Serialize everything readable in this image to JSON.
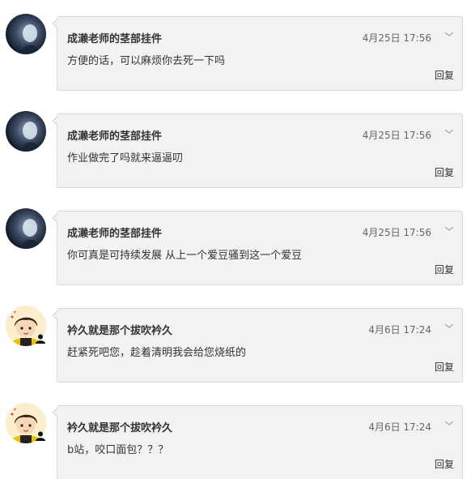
{
  "messages": [
    {
      "sender": "成濑老师的茎部挂件",
      "time": "4月25日 17:56",
      "text": "方便的话，可以麻烦你去死一下吗",
      "reply_label": "回复",
      "avatar_icon": "dark-silhouette-avatar-icon"
    },
    {
      "sender": "成濑老师的茎部挂件",
      "time": "4月25日 17:56",
      "text": "作业做完了吗就来逼逼叨",
      "reply_label": "回复",
      "avatar_icon": "dark-silhouette-avatar-icon"
    },
    {
      "sender": "成濑老师的茎部挂件",
      "time": "4月25日 17:56",
      "text": "你可真是可持续发展 从上一个爱豆骚到这一个爱豆",
      "reply_label": "回复",
      "avatar_icon": "dark-silhouette-avatar-icon"
    },
    {
      "sender": "衿久就是那个拔吹衿久",
      "time": "4月6日 17:24",
      "text": "赶紧死吧您，趁着清明我会给您烧纸的",
      "reply_label": "回复",
      "avatar_icon": "cartoon-boy-avatar-icon"
    },
    {
      "sender": "衿久就是那个拔吹衿久",
      "time": "4月6日 17:24",
      "text": "b站，咬口面包？？？",
      "reply_label": "回复",
      "avatar_icon": "cartoon-boy-avatar-icon"
    }
  ],
  "colors": {
    "bubble_bg": "#f2f2f2",
    "bubble_border": "#d9d9d9",
    "text": "#333333",
    "time": "#666666"
  }
}
